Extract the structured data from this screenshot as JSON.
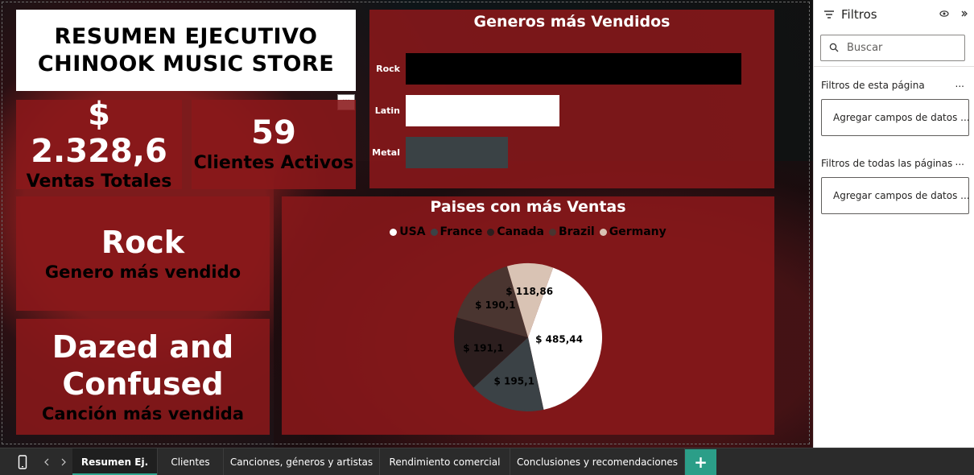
{
  "report": {
    "title_line1": "RESUMEN EJECUTIVO",
    "title_line2": "CHINOOK MUSIC STORE",
    "more_options": "···"
  },
  "kpis": {
    "sales_value": "$ 2.328,6",
    "sales_label": "Ventas Totales",
    "clients_value": "59",
    "clients_label": "Clientes Activos"
  },
  "cards": {
    "genre_value": "Rock",
    "genre_label": "Genero más vendido",
    "song_line1": "Dazed and",
    "song_line2": "Confused",
    "song_label": "Canción más vendida"
  },
  "chart_data": [
    {
      "type": "bar",
      "title": "Generos más Vendidos",
      "orientation": "horizontal",
      "categories": [
        "Rock",
        "Latin",
        "Metal"
      ],
      "values": [
        100,
        45.7,
        30.4
      ],
      "colors": [
        "#000000",
        "#ffffff",
        "#3a4245"
      ]
    },
    {
      "type": "pie",
      "title": "Paises con más Ventas",
      "legend_position": "top",
      "categories": [
        "USA",
        "France",
        "Canada",
        "Brazil",
        "Germany"
      ],
      "values": [
        485.44,
        195.1,
        191.1,
        190.1,
        118.86
      ],
      "labels": [
        "$ 485,44",
        "$ 195,1",
        "$ 191,1",
        "$ 190,1",
        "$ 118,86"
      ],
      "colors": [
        "#ffffff",
        "#3b4246",
        "#2c1e1e",
        "#4a3530",
        "#d9c3b4"
      ]
    }
  ],
  "filters_pane": {
    "title": "Filtros",
    "search_placeholder": "Buscar",
    "page_filters_label": "Filtros de esta página",
    "all_pages_filters_label": "Filtros de todas las páginas",
    "add_fields_1": "Agregar campos de datos ...",
    "add_fields_2": "Agregar campos de datos ...",
    "dots": "..."
  },
  "tabs": [
    {
      "label": "Resumen Ej."
    },
    {
      "label": "Clientes"
    },
    {
      "label": "Canciones, géneros y artistas"
    },
    {
      "label": "Rendimiento comercial"
    },
    {
      "label": "Conclusiones y recomendaciones"
    }
  ],
  "tab_add": "+",
  "colors": {
    "panel": "#8a181a",
    "accent": "#2b9e88",
    "tabbar": "#2b2b2b"
  }
}
